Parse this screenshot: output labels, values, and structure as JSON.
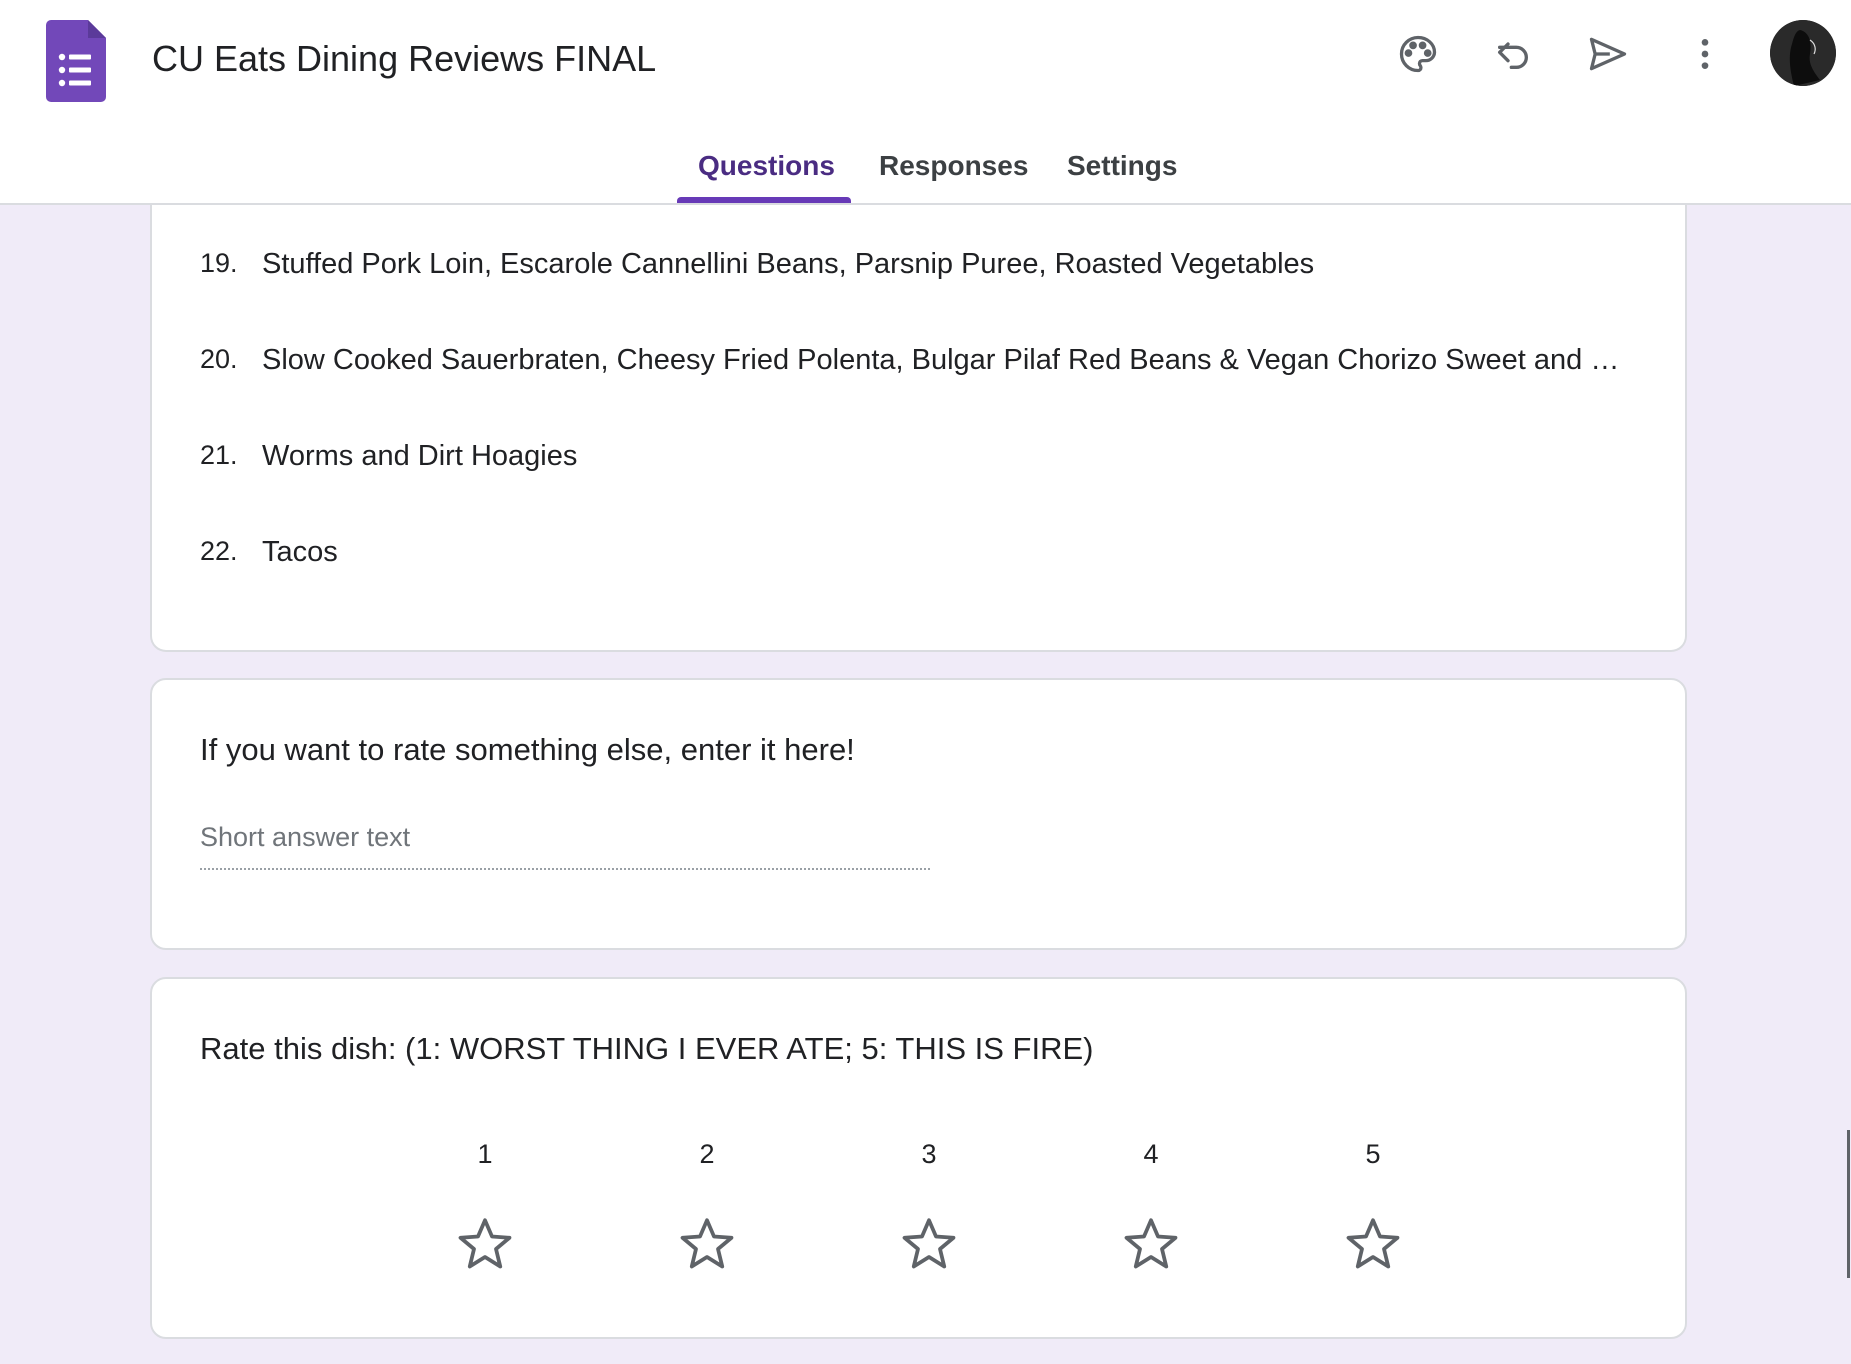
{
  "header": {
    "title": "CU Eats Dining Reviews FINAL",
    "colors": {
      "brand": "#673ab7",
      "background": "#f0ebf8"
    }
  },
  "toolbar": {
    "icons": [
      "palette-icon",
      "undo-icon",
      "send-icon",
      "more-vert-icon",
      "avatar"
    ]
  },
  "tabs": [
    {
      "label": "Questions",
      "active": true
    },
    {
      "label": "Responses",
      "active": false
    },
    {
      "label": "Settings",
      "active": false
    }
  ],
  "dish_list": [
    {
      "number": "19.",
      "text": "Stuffed Pork Loin, Escarole Cannellini Beans, Parsnip Puree, Roasted Vegetables"
    },
    {
      "number": "20.",
      "text": "Slow Cooked Sauerbraten, Cheesy Fried Polenta, Bulgar Pilaf Red Beans & Vegan Chorizo Sweet and Sou…"
    },
    {
      "number": "21.",
      "text": "Worms and Dirt Hoagies"
    },
    {
      "number": "22.",
      "text": "Tacos"
    }
  ],
  "other_question": {
    "title": "If you want to rate something else, enter it here!",
    "placeholder": "Short answer text"
  },
  "rating_question": {
    "title": "Rate this dish: (1: WORST THING I EVER ATE; 5: THIS IS FIRE)",
    "scale": [
      "1",
      "2",
      "3",
      "4",
      "5"
    ],
    "selected": 0
  }
}
